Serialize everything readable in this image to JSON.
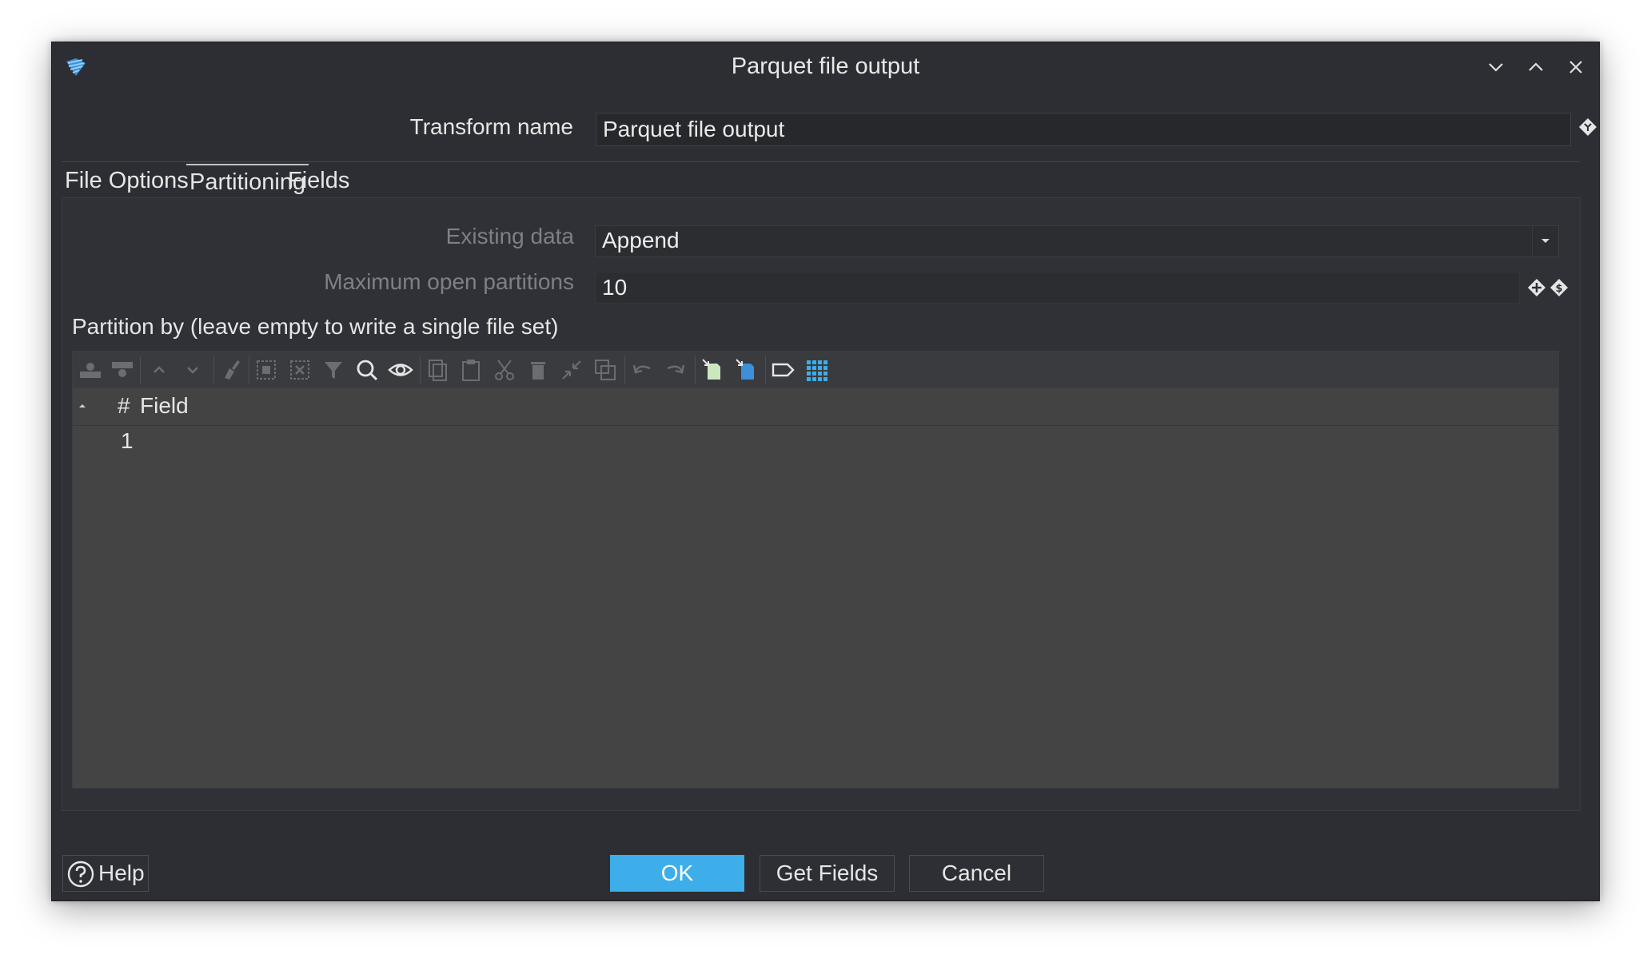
{
  "window": {
    "title": "Parquet file output",
    "controls": [
      "minimize-icon",
      "maximize-icon",
      "close-icon"
    ]
  },
  "transform": {
    "label": "Transform name",
    "value": "Parquet file output"
  },
  "tabs": [
    {
      "label": "File Options",
      "active": false
    },
    {
      "label": "Partitioning",
      "active": true
    },
    {
      "label": "Fields",
      "active": false
    }
  ],
  "partitioning": {
    "existing_data_label": "Existing data",
    "existing_data_value": "Append",
    "max_partitions_label": "Maximum open partitions",
    "max_partitions_value": "10",
    "partition_by_label": "Partition by (leave empty to write a single file set)"
  },
  "grid": {
    "columns": [
      "#",
      "Field"
    ],
    "rows": [
      {
        "num": "1",
        "field": ""
      }
    ],
    "toolbar_icons": [
      "insert-row-before-icon",
      "insert-row-after-icon",
      "move-up-icon",
      "move-down-icon",
      "clear-icon",
      "select-all-icon",
      "unselect-all-icon",
      "filter-icon",
      "search-icon",
      "preview-icon",
      "copy-icon",
      "paste-icon",
      "cut-icon",
      "delete-icon",
      "shrink-icon",
      "duplicate-icon",
      "undo-icon",
      "redo-icon",
      "clipboard-import-icon",
      "clipboard-export-icon",
      "label-icon",
      "grid-icon"
    ]
  },
  "buttons": {
    "help": "Help",
    "ok": "OK",
    "get_fields": "Get Fields",
    "cancel": "Cancel"
  },
  "colors": {
    "window_bg": "#2c2e33",
    "grid_bg": "#444444",
    "accent": "#3daee9",
    "title_text": "#e8e8e8",
    "disabled_label": "#7c8088"
  }
}
